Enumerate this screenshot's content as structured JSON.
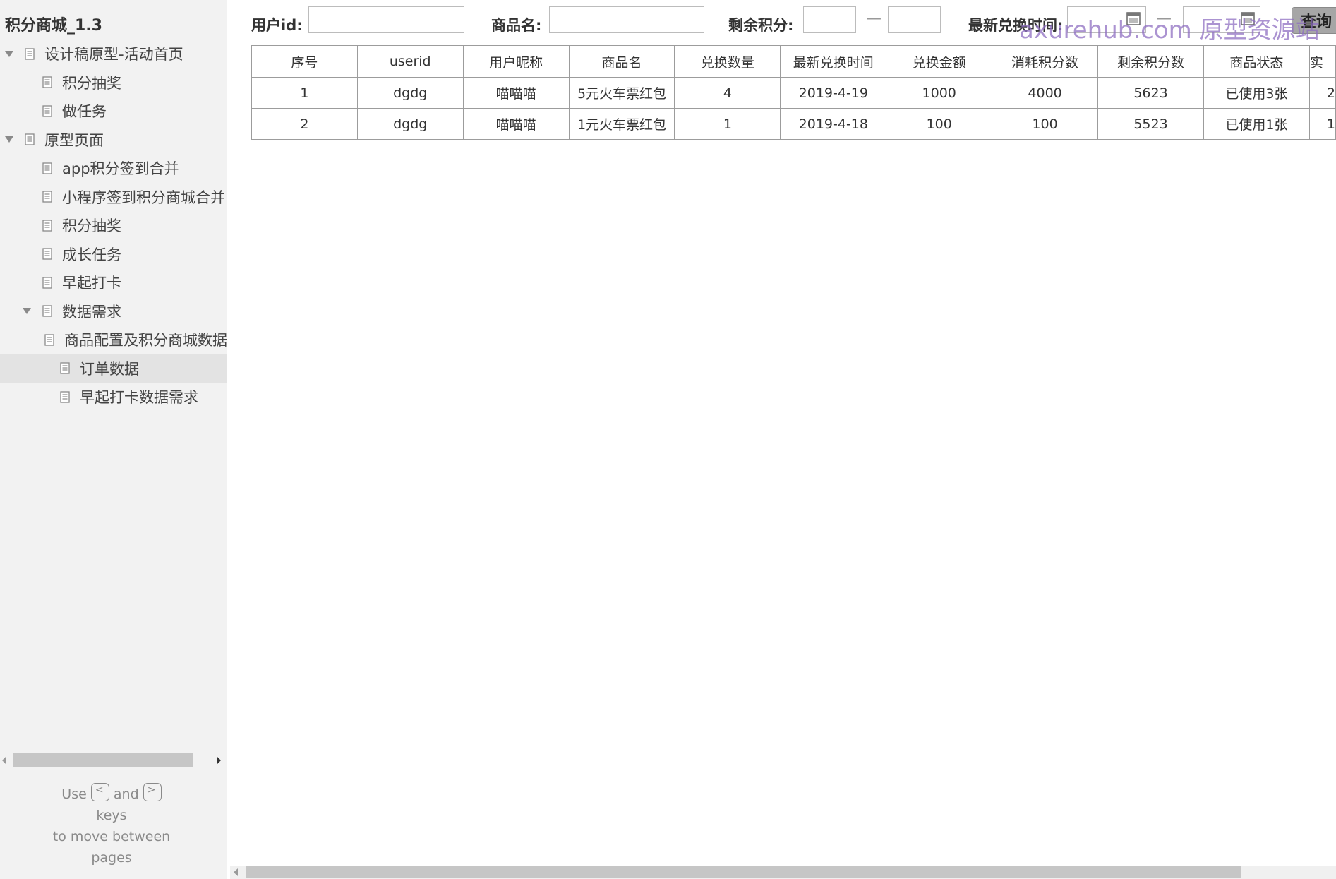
{
  "sidebar": {
    "project_title": "积分商城_1.3",
    "items": [
      {
        "label": "设计稿原型-活动首页",
        "level": 0,
        "expanded": true,
        "selected": false
      },
      {
        "label": "积分抽奖",
        "level": 1,
        "selected": false
      },
      {
        "label": "做任务",
        "level": 1,
        "selected": false
      },
      {
        "label": "原型页面",
        "level": 0,
        "expanded": true,
        "selected": false
      },
      {
        "label": "app积分签到合并",
        "level": 1,
        "selected": false
      },
      {
        "label": "小程序签到积分商城合并",
        "level": 1,
        "selected": false
      },
      {
        "label": "积分抽奖",
        "level": 1,
        "selected": false
      },
      {
        "label": "成长任务",
        "level": 1,
        "selected": false
      },
      {
        "label": "早起打卡",
        "level": 1,
        "selected": false
      },
      {
        "label": "数据需求",
        "level": 1,
        "expanded": true,
        "selected": false
      },
      {
        "label": "商品配置及积分商城数据",
        "level": 2,
        "selected": false
      },
      {
        "label": "订单数据",
        "level": 2,
        "selected": true
      },
      {
        "label": "早起打卡数据需求",
        "level": 2,
        "selected": false
      }
    ],
    "hint": {
      "use": "Use",
      "and": "and",
      "keys": "keys",
      "move": "to move between",
      "pages": "pages",
      "prev_key": "<",
      "next_key": ">"
    }
  },
  "filters": {
    "userid_label": "用户id:",
    "userid_value": "",
    "product_label": "商品名:",
    "product_value": "",
    "points_label": "剩余积分:",
    "points_min": "",
    "points_max": "",
    "range_dash": "—",
    "time_label": "最新兑换时间:",
    "time_start": "",
    "time_end": "",
    "query_label": "查询"
  },
  "watermark": "axurehub.com 原型资源站",
  "table": {
    "headers": [
      "序号",
      "userid",
      "用户昵称",
      "商品名",
      "兑换数量",
      "最新兑换时间",
      "兑换金额",
      "消耗积分数",
      "剩余积分数",
      "商品状态",
      "实"
    ],
    "rows": [
      [
        "1",
        "dgdg",
        "喵喵喵",
        "5元火车票红包",
        "4",
        "2019-4-19",
        "1000",
        "4000",
        "5623",
        "已使用3张",
        "2"
      ],
      [
        "2",
        "dgdg",
        "喵喵喵",
        "1元火车票红包",
        "1",
        "2019-4-18",
        "100",
        "100",
        "5523",
        "已使用1张",
        "1"
      ]
    ]
  },
  "colors": {
    "sidebar_bg": "#f2f2f2",
    "selected_bg": "#e3e3e3",
    "watermark": "#8f6fc2",
    "button_bg": "#a6a6a6"
  }
}
